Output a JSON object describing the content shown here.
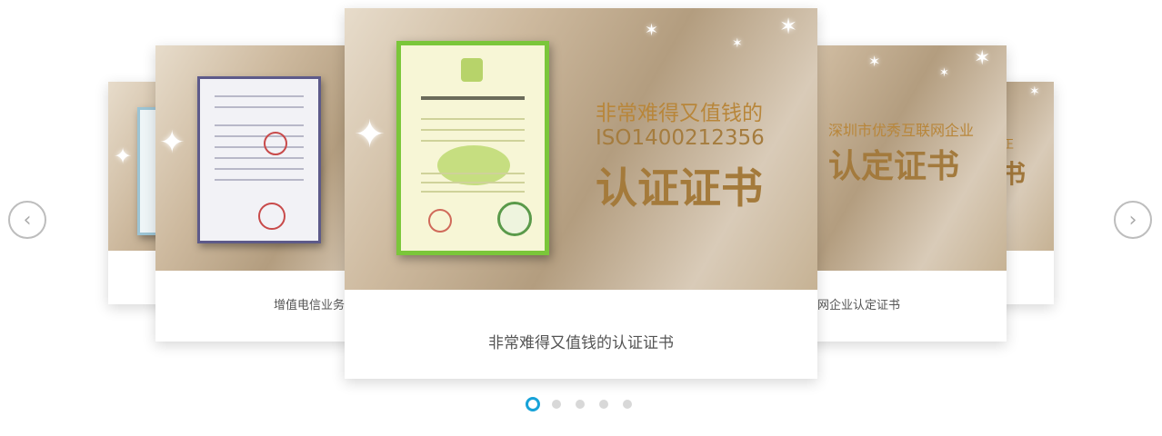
{
  "slides": [
    {
      "caption": "增值电信业务"
    },
    {
      "caption": "非常难得又值钱的认证证书",
      "headline_line1": "非常难得又值钱的",
      "headline_line2": "ISO1400212356",
      "headline_big": "认证证书"
    },
    {
      "caption": "网企业认定证书",
      "headline_line1": "深圳市优秀互联网企业",
      "headline_big": "认定证书"
    }
  ],
  "far_right_fragment": {
    "small": "正",
    "big": "书"
  },
  "carousel": {
    "prev_label": "‹",
    "next_label": "›",
    "active_index": 0,
    "dot_count": 5
  },
  "colors": {
    "accent": "#17a2d8",
    "headline_gold": "#b8863a",
    "caption": "#555555"
  }
}
